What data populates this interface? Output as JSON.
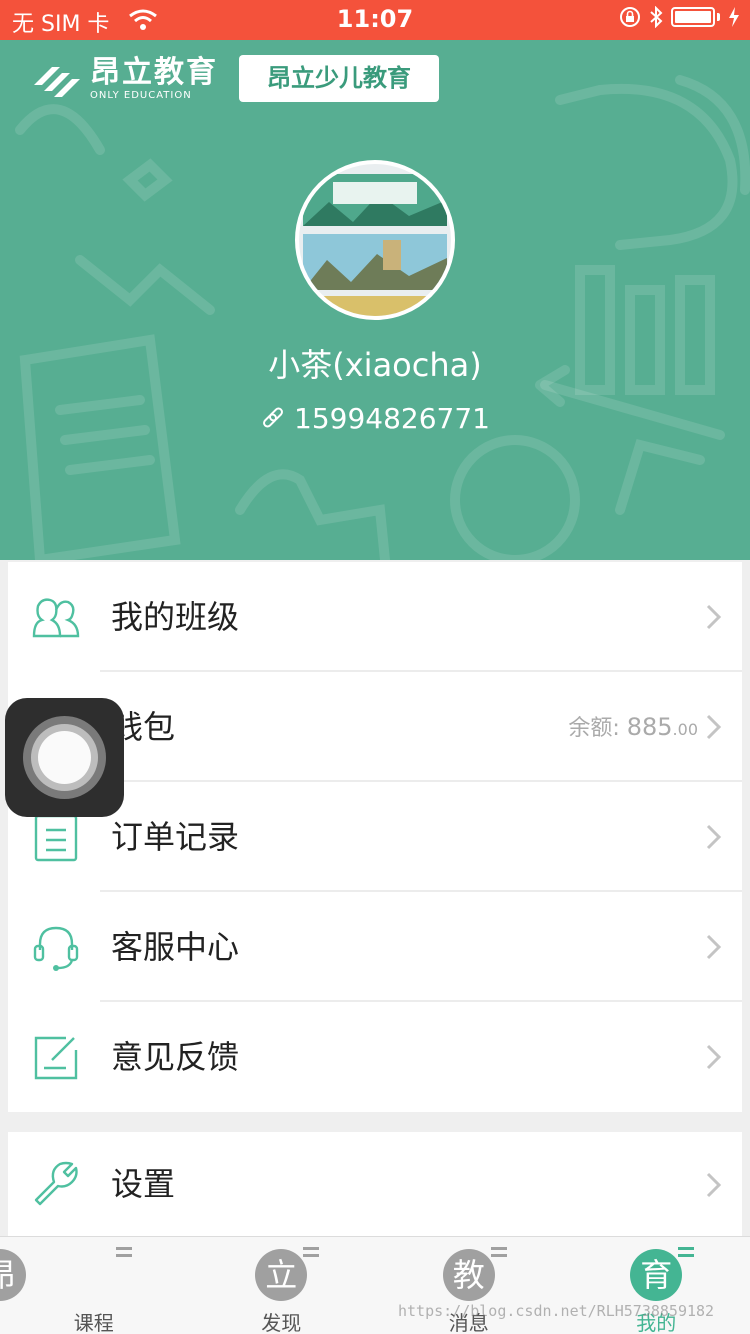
{
  "status_bar": {
    "carrier": "无 SIM 卡",
    "time": "11:07"
  },
  "header": {
    "logo_cn": "昂立教育",
    "logo_en": "ONLY EDUCATION",
    "brand_button": "昂立少儿教育",
    "username": "小茶(xiaocha)",
    "phone": "15994826771",
    "background_color": "#57ae92"
  },
  "menu": [
    {
      "label": "我的班级",
      "icon": "class-group-icon"
    },
    {
      "label": "钱包",
      "icon": "wallet-icon",
      "balance_label": "余额:",
      "balance_int": "885",
      "balance_dec": ".00"
    },
    {
      "label": "订单记录",
      "icon": "order-list-icon"
    },
    {
      "label": "客服中心",
      "icon": "headset-icon"
    },
    {
      "label": "意见反馈",
      "icon": "feedback-edit-icon"
    }
  ],
  "settings": {
    "label": "设置",
    "icon": "wrench-icon"
  },
  "tabs": [
    {
      "glyph": "昂",
      "label": "课程",
      "active": false
    },
    {
      "glyph": "立",
      "label": "发现",
      "active": false
    },
    {
      "glyph": "教",
      "label": "消息",
      "active": false
    },
    {
      "glyph": "育",
      "label": "我的",
      "active": true
    }
  ],
  "watermark": "https://blog.csdn.net/RLH5738859182",
  "colors": {
    "status_bar": "#f4523b",
    "accent": "#44b593",
    "icon_stroke": "#4fc0a0"
  }
}
